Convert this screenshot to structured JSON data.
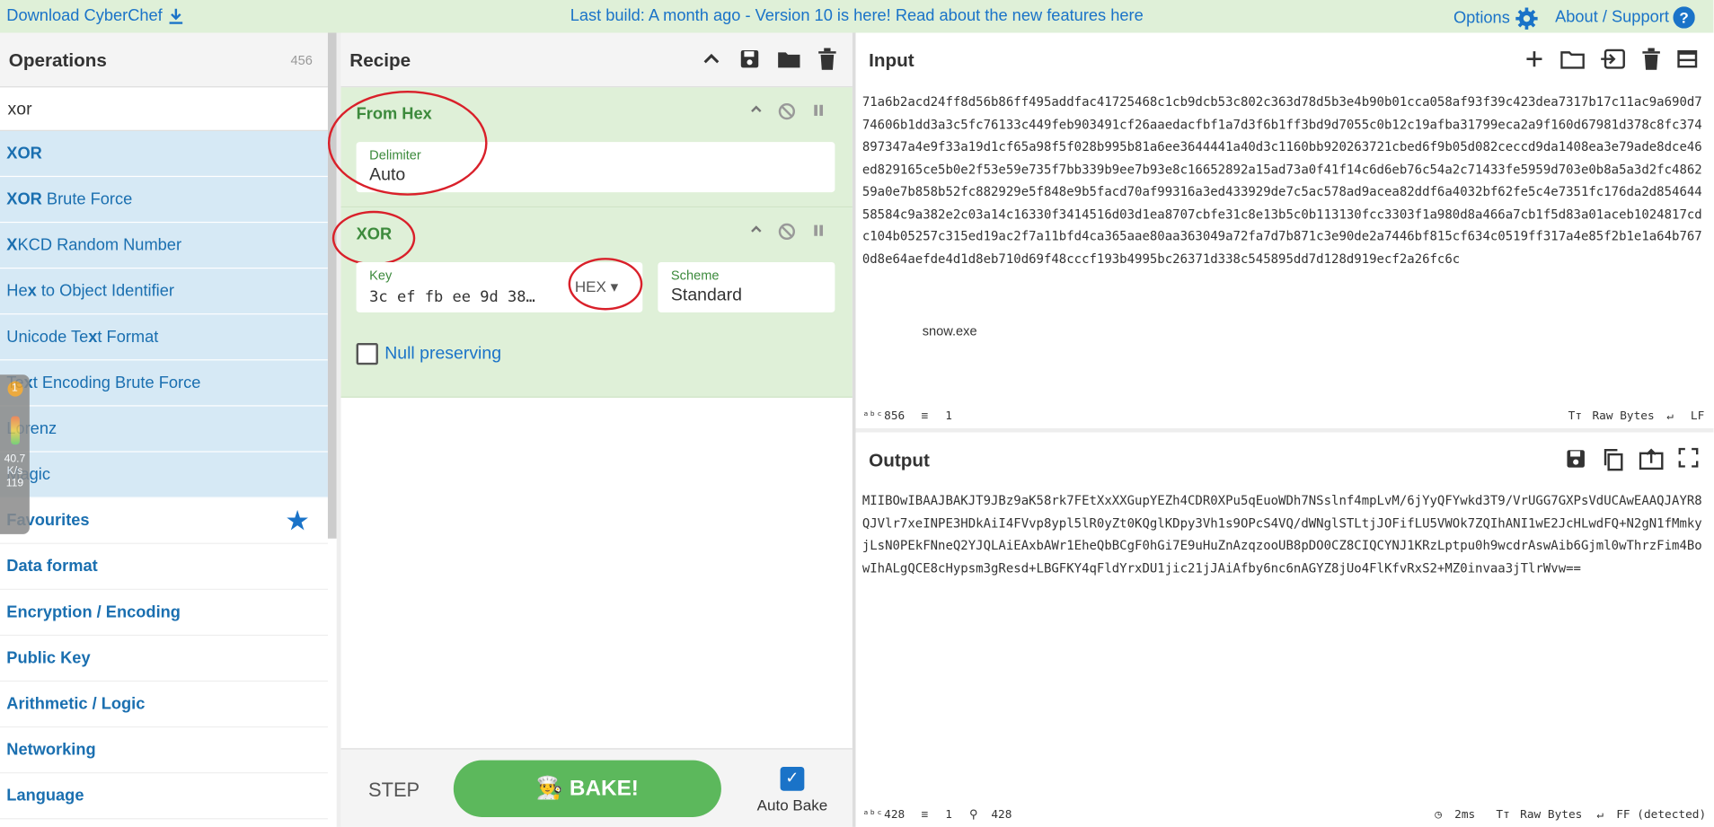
{
  "topbar": {
    "download": "Download CyberChef",
    "notice": "Last build: A month ago - Version 10 is here! Read about the new features here",
    "options": "Options",
    "about": "About / Support"
  },
  "operations": {
    "title": "Operations",
    "count": "456",
    "search": "xor",
    "results": [
      {
        "pre": "",
        "hl": "XOR",
        "post": ""
      },
      {
        "pre": "",
        "hl": "XOR",
        "post": " Brute Force"
      },
      {
        "pre": "",
        "hl": "X",
        "post": "KCD Random Number"
      },
      {
        "pre": "He",
        "hl": "x",
        "post": " to Object Identifier"
      },
      {
        "pre": "Unicode Te",
        "hl": "x",
        "post": "t Format"
      },
      {
        "pre": "Te",
        "hl": "x",
        "post": "t Encoding Brute Force"
      },
      {
        "pre": "",
        "hl": "",
        "post": "Lorenz"
      },
      {
        "pre": "",
        "hl": "",
        "post": "Magic"
      }
    ],
    "categories": [
      "Favourites",
      "Data format",
      "Encryption / Encoding",
      "Public Key",
      "Arithmetic / Logic",
      "Networking",
      "Language"
    ]
  },
  "widget": {
    "badge": "1",
    "v1": "40.7",
    "v2": "K/s",
    "v3": "119"
  },
  "recipe": {
    "title": "Recipe",
    "from_hex": {
      "title": "From Hex",
      "delimiter_label": "Delimiter",
      "delimiter_value": "Auto"
    },
    "xor": {
      "title": "XOR",
      "key_label": "Key",
      "key_value": "3c ef fb ee 9d 38…",
      "key_format": "HEX",
      "scheme_label": "Scheme",
      "scheme_value": "Standard",
      "null_label": "Null preserving"
    },
    "step": "STEP",
    "bake": "BAKE!",
    "autobake": "Auto Bake"
  },
  "input": {
    "title": "Input",
    "text": "71a6b2acd24ff8d56b86ff495addfac41725468c1cb9dcb53c802c363d78d5b3e4b90b01cca058af93f39c423dea7317b17c11ac9a690d774606b1dd3a3c5fc76133c449feb903491cf26aaedacfbf1a7d3f6b1ff3bd9d7055c0b12c19afba31799eca2a9f160d67981d378c8fc374897347a4e9f33a19d1cf65a98f5f028b995b81a6ee3644441a40d3c1160bb920263721cbed6f9b05d082ceccd9da1408ea3e79ade8dce46ed829165ce5b0e2f53e59e735f7bb339b9ee7b93e8c16652892a15ad73a0f41f14c6d6eb76c54a2c71433fe5959d703e0b8a5a3d2fc486259a0e7b858b52fc882929e5f848e9b5facd70af99316a3ed433929de7c5ac578ad9acea82ddf6a4032bf62fe5c4e7351fc176da2d85464458584c9a382e2c03a14c16330f3414516d03d1ea8707cbfe31c8e13b5c0b113130fcc3303f1a980d8a466a7cb1f5d83a01aceb1024817cdc104b05257c315ed19ac2f7a11bfd4ca365aae80aa363049a72fa7d7b871c3e90de2a7446bf815cf634c0519ff317a4e85f2b1e1a64b7670d8e64aefde4d1d8eb710d69f48cccf193b4995bc26371d338c545895dd7d128d919ecf2a26fc6c",
    "filename": "snow.exe",
    "chars": "856",
    "lines": "1",
    "encoding": "Raw Bytes",
    "eol": "LF"
  },
  "output": {
    "title": "Output",
    "text": "MIIBOwIBAAJBAKJT9JBz9aK58rk7FEtXxXXGupYEZh4CDR0XPu5qEuoWDh7NSslnf4mpLvM/6jYyQFYwkd3T9/VrUGG7GXPsVdUCAwEAAQJAYR8QJVlr7xeINPE3HDkAiI4FVvp8ypl5lR0yZt0KQglKDpy3Vh1s9OPcS4VQ/dWNglSTLtjJOFifLU5VWOk7ZQIhANI1wE2JcHLwdFQ+N2gN1fMmkyjLsN0PEkFNneQ2YJQLAiEAxbAWr1EheQbBCgF0hGi7E9uHuZnAzqzooUB8pDO0CZ8CIQCYNJ1KRzLptpu0h9wcdrAswAib6Gjml0wThrzFim4BowIhALgQCE8cHypsm3gResd+LBGFKY4qFldYrxDU1jic21jJAiAfby6nc6nAGYZ8jUo4FlKfvRxS2+MZ0invaa3jTlrWvw==",
    "chars": "428",
    "lines": "1",
    "pos": "428",
    "time": "2ms",
    "encoding": "Raw Bytes",
    "eol": "FF (detected)"
  }
}
